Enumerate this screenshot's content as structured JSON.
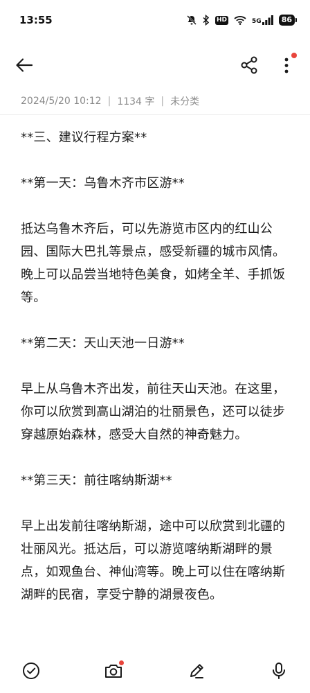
{
  "status_bar": {
    "time": "13:55",
    "hd_label": "HD",
    "network_label": "5G",
    "battery": "86"
  },
  "toolbar": {
    "back_icon": "arrow-left-icon",
    "share_icon": "share-icon",
    "more_icon": "more-vertical-icon",
    "notification_color": "#e8453c"
  },
  "meta": {
    "date": "2024/5/20 10:12",
    "separator": "|",
    "word_count": "1134 字",
    "category": "未分类"
  },
  "note": {
    "paragraphs": [
      "**三、建议行程方案**",
      "**第一天：乌鲁木齐市区游**",
      "抵达乌鲁木齐后，可以先游览市区内的红山公园、国际大巴扎等景点，感受新疆的城市风情。晚上可以品尝当地特色美食，如烤全羊、手抓饭等。",
      "**第二天：天山天池一日游**",
      "早上从乌鲁木齐出发，前往天山天池。在这里，你可以欣赏到高山湖泊的壮丽景色，还可以徒步穿越原始森林，感受大自然的神奇魅力。",
      "**第三天：前往喀纳斯湖**",
      "早上出发前往喀纳斯湖，途中可以欣赏到北疆的壮丽风光。抵达后，可以游览喀纳斯湖畔的景点，如观鱼台、神仙湾等。晚上可以住在喀纳斯湖畔的民宿，享受宁静的湖景夜色。"
    ]
  },
  "bottom_bar": {
    "icons": [
      "checklist-icon",
      "camera-icon",
      "pen-icon",
      "microphone-icon"
    ]
  }
}
